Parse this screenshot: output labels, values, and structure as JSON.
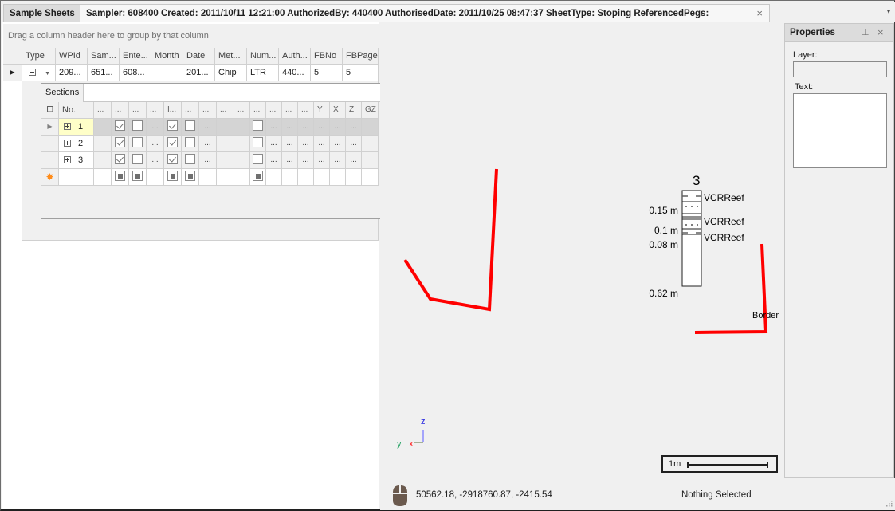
{
  "tabs": [
    {
      "label": "Sample Sheets",
      "active": false
    },
    {
      "label": "Sampler: 608400 Created: 2011/10/11 12:21:00 AuthorizedBy: 440400 AuthorisedDate: 2011/10/25 08:47:37 SheetType: Stoping ReferencedPegs:",
      "active": true,
      "closable": true
    }
  ],
  "tab_close_icon": "×",
  "tab_menu_icon": "▾",
  "grid": {
    "group_panel_text": "Drag a column header here to group by that column",
    "columns": [
      "Type",
      "WPId",
      "Sam...",
      "Ente...",
      "Month",
      "Date",
      "Met...",
      "Num...",
      "Auth...",
      "FBNo",
      "FBPage"
    ],
    "rows": [
      {
        "Type": "",
        "WPId": "209...",
        "Sam": "651...",
        "Ente": "608...",
        "Month": "",
        "Date": "201...",
        "Met": "Chip",
        "Num": "LTR",
        "Auth": "440...",
        "FBNo": "5",
        "FBPage": "5",
        "expanded": true
      }
    ],
    "detail": {
      "tab_label": "Sections",
      "columns": [
        "No.",
        "...",
        "...",
        "...",
        "...",
        "I...",
        "...",
        "...",
        "...",
        "...",
        "...",
        "...",
        "...",
        "...",
        "Y",
        "X",
        "Z",
        "GZ"
      ],
      "rows": [
        {
          "no": "1",
          "focused": true,
          "c1": "",
          "chk1": true,
          "chk2": false,
          "c4": "...",
          "chk3": true,
          "chk4": false,
          "c7": "...",
          "c8": "",
          "c9": "",
          "chk5": false,
          "c11": "...",
          "c12": "...",
          "c13": "...",
          "Y": "...",
          "X": "...",
          "Z": "...",
          "GZ": ""
        },
        {
          "no": "2",
          "focused": false,
          "c1": "",
          "chk1": true,
          "chk2": false,
          "c4": "...",
          "chk3": true,
          "chk4": false,
          "c7": "...",
          "c8": "",
          "c9": "",
          "chk5": false,
          "c11": "...",
          "c12": "...",
          "c13": "...",
          "Y": "...",
          "X": "...",
          "Z": "...",
          "GZ": ""
        },
        {
          "no": "3",
          "focused": false,
          "c1": "",
          "chk1": true,
          "chk2": false,
          "c4": "...",
          "chk3": true,
          "chk4": false,
          "c7": "...",
          "c8": "",
          "c9": "",
          "chk5": false,
          "c11": "...",
          "c12": "...",
          "c13": "...",
          "Y": "...",
          "X": "...",
          "Z": "...",
          "GZ": ""
        }
      ],
      "new_row_icon": "✸"
    }
  },
  "viewport": {
    "section_number": "3",
    "depth_labels": [
      "0.15 m",
      "0.1 m",
      "0.08 m",
      "0.62 m"
    ],
    "reef_labels": [
      "VCRReef",
      "VCRReef",
      "VCRReef"
    ],
    "border_label": "Border",
    "axis_labels": {
      "z": "z",
      "y": "y",
      "x": "x"
    },
    "line_color": "#ff0000",
    "scale_label": "1m"
  },
  "properties": {
    "title": "Properties",
    "pin_icon": "⊥",
    "close_icon": "×",
    "layer_label": "Layer:",
    "layer_value": "",
    "text_label": "Text:",
    "text_value": ""
  },
  "status": {
    "coordinates": "50562.18, -2918760.87, -2415.54",
    "selection": "Nothing Selected"
  }
}
